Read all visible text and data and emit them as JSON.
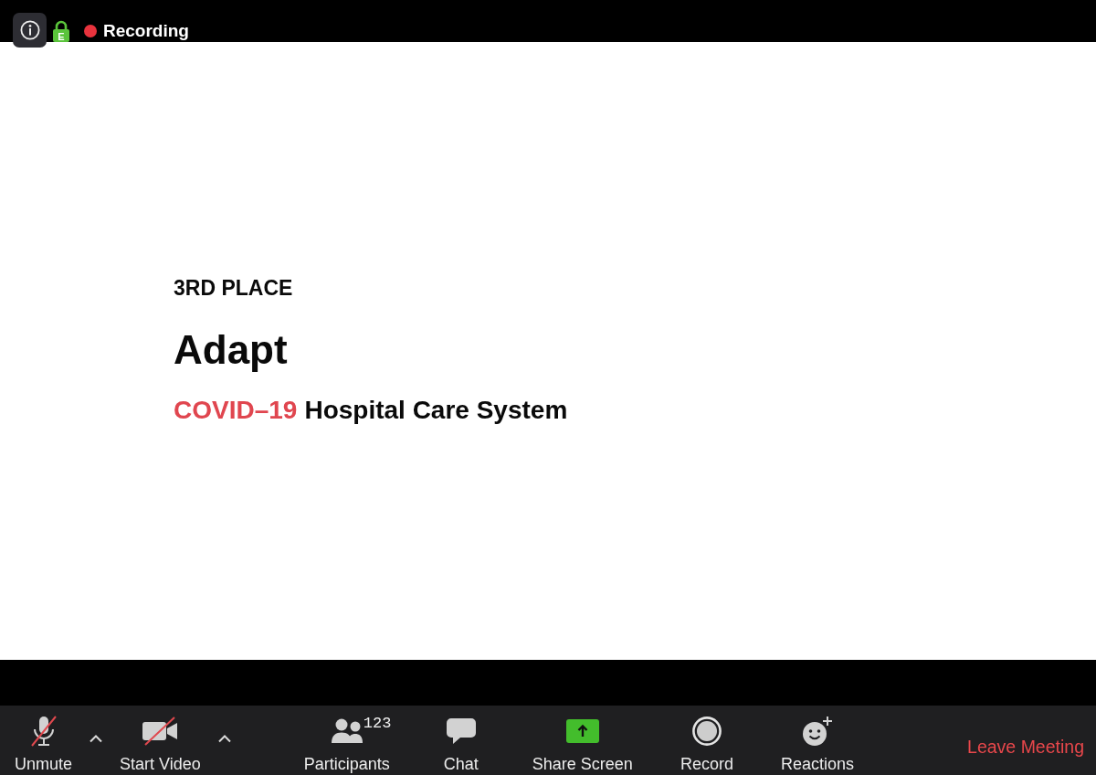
{
  "meeting_header": {
    "encryption_badge": "E"
  },
  "recording": {
    "on": true,
    "label": "Recording"
  },
  "slide": {
    "eyebrow": "3RD PLACE",
    "title": "Adapt",
    "subtitle_highlight": "COVID–19",
    "subtitle": "Hospital Care System"
  },
  "toolbar": {
    "buttons": [
      {
        "kind": "mic",
        "label": "Unmute",
        "off": true,
        "has_menu": true
      },
      {
        "kind": "video",
        "label": "Start Video",
        "off": true,
        "has_menu": true
      },
      {
        "kind": "participants",
        "label": "Participants",
        "count": "123",
        "has_menu": false
      },
      {
        "kind": "chat",
        "label": "Chat",
        "has_menu": false
      },
      {
        "kind": "share",
        "label": "Share Screen",
        "has_menu": false
      },
      {
        "kind": "record",
        "label": "Record",
        "has_menu": false
      },
      {
        "kind": "reactions",
        "label": "Reactions",
        "has_menu": false
      }
    ],
    "leave_button": "Leave Meeting"
  }
}
